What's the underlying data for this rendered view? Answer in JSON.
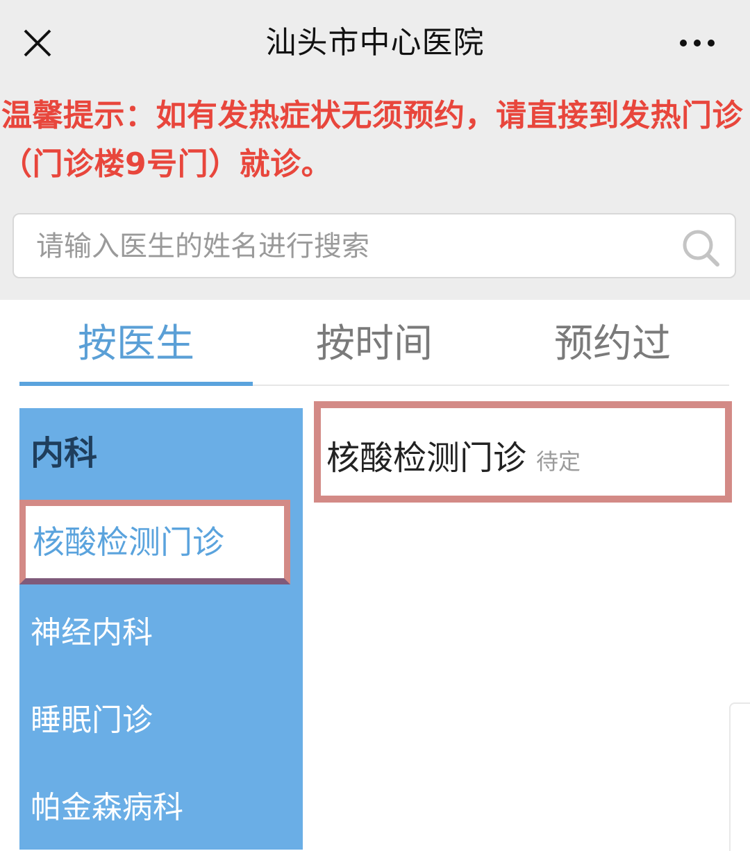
{
  "header": {
    "title": "汕头市中心医院",
    "close_icon": "close-icon",
    "more_icon": "more-icon"
  },
  "notice": {
    "text": "温馨提示：如有发热症状无须预约，请直接到发热门诊（门诊楼9号门）就诊。",
    "color": "#e8463c"
  },
  "search": {
    "placeholder": "请输入医生的姓名进行搜索",
    "value": "",
    "icon": "search-icon"
  },
  "tabs": [
    {
      "label": "按医生",
      "active": true
    },
    {
      "label": "按时间",
      "active": false
    },
    {
      "label": "预约过",
      "active": false
    }
  ],
  "departments": {
    "category": "内科",
    "selected": "核酸检测门诊",
    "items": [
      "神经内科",
      "睡眠门诊",
      "帕金森病科"
    ]
  },
  "clinic": {
    "name": "核酸检测门诊",
    "status": "待定"
  },
  "colors": {
    "accent": "#5aa3dd",
    "sidebar": "#6aaee6",
    "highlight_border": "#d38a86"
  }
}
